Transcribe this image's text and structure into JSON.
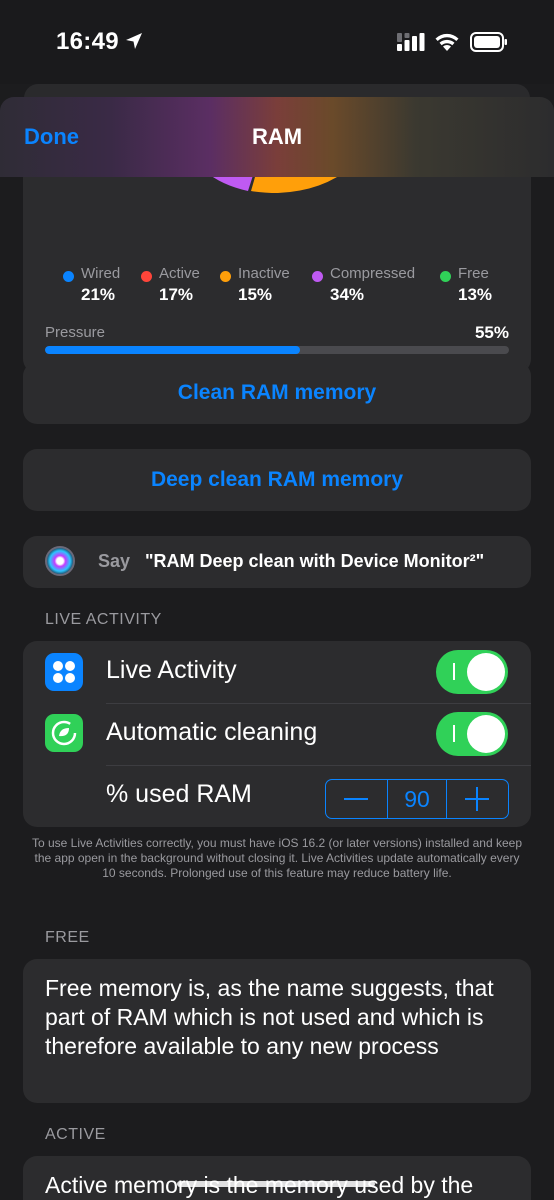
{
  "status_bar": {
    "time": "16:49"
  },
  "nav": {
    "done_label": "Done",
    "title": "RAM"
  },
  "legend": [
    {
      "label": "Wired",
      "value": "21%",
      "color": "#0a84ff"
    },
    {
      "label": "Active",
      "value": "17%",
      "color": "#ff453a"
    },
    {
      "label": "Inactive",
      "value": "15%",
      "color": "#ff9f0a"
    },
    {
      "label": "Compressed",
      "value": "34%",
      "color": "#bf5af2"
    },
    {
      "label": "Free",
      "value": "13%",
      "color": "#30d158"
    }
  ],
  "pressure": {
    "label": "Pressure",
    "value": "55%",
    "fraction": 0.55
  },
  "buttons": {
    "clean": "Clean RAM memory",
    "deep_clean": "Deep clean RAM memory"
  },
  "siri": {
    "say": "Say",
    "phrase": "\"RAM Deep clean with Device Monitor²\""
  },
  "live_activity": {
    "header": "LIVE ACTIVITY",
    "live_activity_label": "Live Activity",
    "auto_clean_label": "Automatic cleaning",
    "used_ram_label": "% used RAM",
    "used_ram_value": "90",
    "live_activity_on": true,
    "auto_clean_on": true
  },
  "footnote": "To use Live Activities correctly, you must have iOS 16.2 (or later versions) installed and keep the app open in the background without closing it. Live Activities update automatically every 10 seconds. Prolonged use of this feature may reduce battery life.",
  "sections": {
    "free_header": "FREE",
    "free_text": "Free memory is, as the name suggests, that part of RAM which is not used and which is therefore available to any new process",
    "active_header": "ACTIVE",
    "active_text": "Active memory is the memory used by the"
  }
}
